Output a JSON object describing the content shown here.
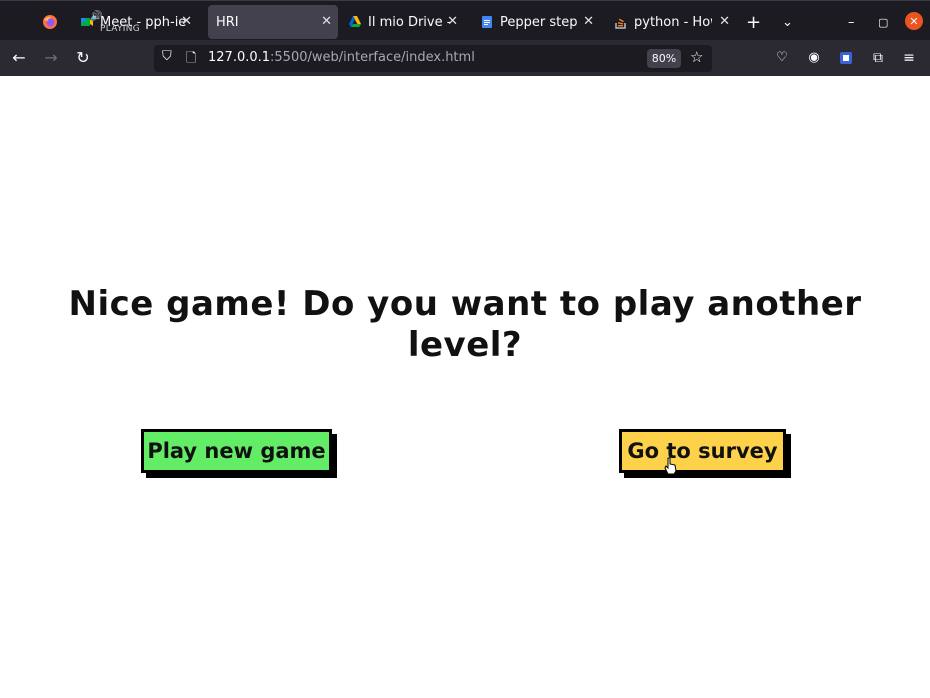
{
  "browser": {
    "tabs": [
      {
        "title": "Meet - pph-ieb",
        "subtitle": "PLAYING",
        "active": false
      },
      {
        "title": "HRI",
        "active": true
      },
      {
        "title": "Il mio Drive - G",
        "active": false
      },
      {
        "title": "Pepper steps",
        "active": false
      },
      {
        "title": "python - How",
        "active": false
      }
    ],
    "url_host": "127.0.0.1",
    "url_path": ":5500/web/interface/index.html",
    "zoom": "80%"
  },
  "page": {
    "question": "Nice game! Do you want to play another level?",
    "play_button": "Play new game",
    "survey_button": "Go to survey"
  },
  "colors": {
    "play_button_bg": "#63ec66",
    "survey_button_bg": "#fdd24a"
  }
}
